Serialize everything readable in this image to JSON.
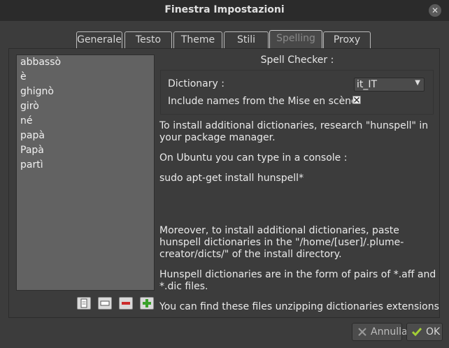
{
  "window": {
    "title": "Finestra Impostazioni"
  },
  "tabs": [
    {
      "label": "Generale"
    },
    {
      "label": "Testo"
    },
    {
      "label": "Theme"
    },
    {
      "label": "Stili"
    },
    {
      "label": "Spelling"
    },
    {
      "label": "Proxy"
    }
  ],
  "active_tab": "Spelling",
  "word_list": [
    "abbassò",
    "è",
    "ghignò",
    "girò",
    "né",
    "papà",
    "Papà",
    "partì"
  ],
  "spell_checker": {
    "title": "Spell Checker :",
    "dictionary_label": "Dictionary :",
    "dictionary_value": "it_IT",
    "include_names_label": "Include names from the Mise en scène",
    "include_names_checked": true
  },
  "info": {
    "p1": "To install additional dictionaries, research \"hunspell\" in your package manager.",
    "p2": "On Ubuntu you can type in a console :",
    "p3": "sudo apt-get install hunspell*",
    "p4": "Moreover, to install additional dictionaries, paste hunspell dictionaries in the \"/home/[user]/.plume-creator/dicts/\" of the install directory.",
    "p5": "Hunspell dictionaries are in the form of pairs of *.aff and *.dic files.",
    "p6": "You can find these files unzipping dictionaries extensions"
  },
  "buttons": {
    "cancel": "Annulla",
    "ok": "OK"
  },
  "colors": {
    "add": "#3aa12a",
    "remove": "#cc2b2b"
  }
}
